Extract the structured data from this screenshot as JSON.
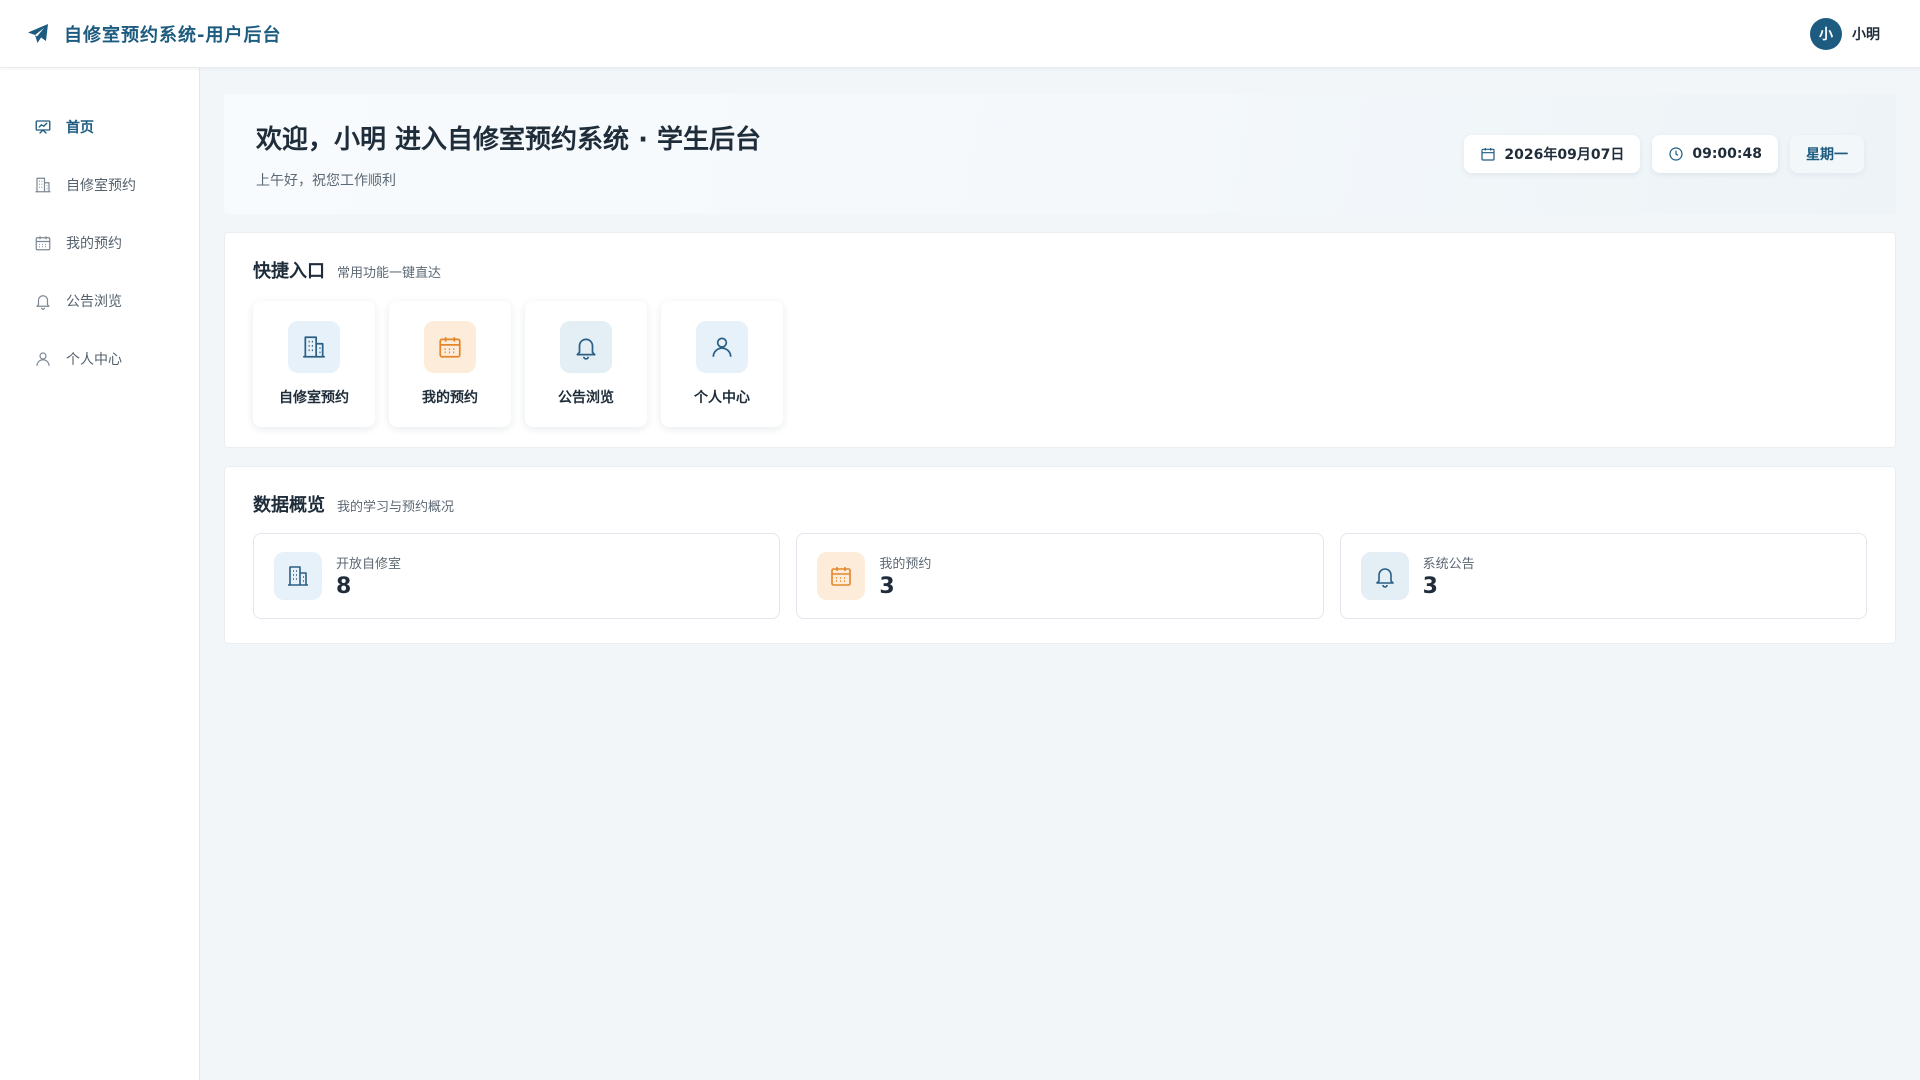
{
  "header": {
    "app_title": "自修室预约系统-用户后台",
    "avatar_text": "小",
    "user_name": "小明"
  },
  "sidebar": {
    "items": [
      {
        "label": "首页",
        "icon": "home-icon",
        "active": true
      },
      {
        "label": "自修室预约",
        "icon": "building-icon",
        "active": false
      },
      {
        "label": "我的预约",
        "icon": "calendar-icon",
        "active": false
      },
      {
        "label": "公告浏览",
        "icon": "bell-icon",
        "active": false
      },
      {
        "label": "个人中心",
        "icon": "user-icon",
        "active": false
      }
    ]
  },
  "welcome": {
    "title": "欢迎，小明 进入自修室预约系统 · 学生后台",
    "subtitle": "上午好，祝您工作顺利",
    "date": "2026年09月07日",
    "time": "09:00:48",
    "weekday": "星期一"
  },
  "quick_access": {
    "title": "快捷入口",
    "subtitle": "常用功能一键直达",
    "items": [
      {
        "label": "自修室预约",
        "icon": "building-icon",
        "color": "#e6f1fa"
      },
      {
        "label": "我的预约",
        "icon": "calendar-icon",
        "color": "#fdecd9"
      },
      {
        "label": "公告浏览",
        "icon": "bell-icon",
        "color": "#e4eef5"
      },
      {
        "label": "个人中心",
        "icon": "user-icon",
        "color": "#e6f1fa"
      }
    ]
  },
  "overview": {
    "title": "数据概览",
    "subtitle": "我的学习与预约概况",
    "stats": [
      {
        "label": "开放自修室",
        "value": "8",
        "icon": "building-icon"
      },
      {
        "label": "我的预约",
        "value": "3",
        "icon": "calendar-icon"
      },
      {
        "label": "系统公告",
        "value": "3",
        "icon": "bell-icon"
      }
    ]
  },
  "colors": {
    "brand": "#1d5c80",
    "accent_orange": "#e3862a",
    "background": "#f2f6f9"
  }
}
